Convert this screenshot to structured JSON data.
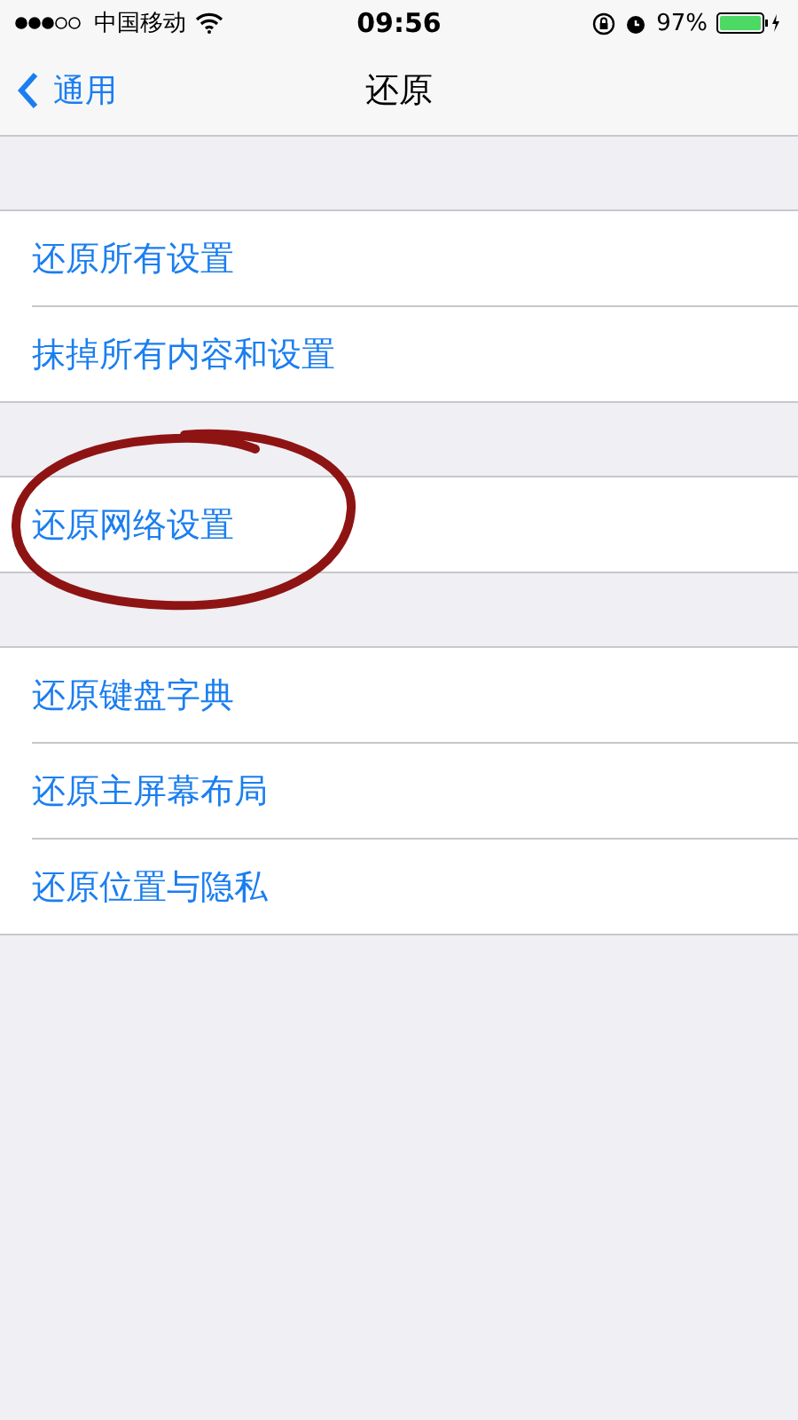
{
  "status_bar": {
    "carrier": "中国移动",
    "time": "09:56",
    "battery_percent": "97%"
  },
  "nav": {
    "back": "通用",
    "title": "还原"
  },
  "groups": [
    {
      "items": [
        {
          "label": "还原所有设置",
          "circled": false
        },
        {
          "label": "抹掉所有内容和设置",
          "circled": false
        }
      ]
    },
    {
      "items": [
        {
          "label": "还原网络设置",
          "circled": true
        }
      ]
    },
    {
      "items": [
        {
          "label": "还原键盘字典",
          "circled": false
        },
        {
          "label": "还原主屏幕布局",
          "circled": false
        },
        {
          "label": "还原位置与隐私",
          "circled": false
        }
      ]
    }
  ]
}
